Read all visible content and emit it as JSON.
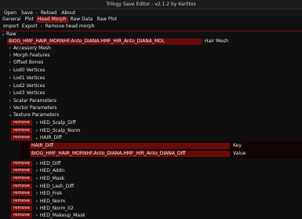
{
  "window": {
    "title": "Trilogy Save Editor - v2.1.2 by Karlitos"
  },
  "menubar": {
    "items": [
      "Open",
      "Save",
      "Reload",
      "About"
    ],
    "separators": [
      "-",
      "-"
    ]
  },
  "tabs": [
    "General",
    "Plot",
    "Head Morph",
    "Raw Data",
    "Raw Plot"
  ],
  "active_tab": "Head Morph",
  "actions": {
    "import": "Import",
    "export": "Export",
    "remove": "Remove head morph",
    "sep": "-"
  },
  "tree": {
    "raw_label": "Raw",
    "hair_mesh_value": "BIOG_HMF_HAIR_MORNHF.Anto_DIANA.HMF_HIR_Anto_DIANA_MDL",
    "hair_mesh_label": "Hair Mesh",
    "sections": [
      "Accessory Mesh",
      "Morph Features",
      "Offset Bones",
      "Lod0 Vertices",
      "Lod1 Vertices",
      "Lod2 Vertices",
      "Lod3 Vertices",
      "Scalar Parameters",
      "Vector Parameters",
      "Texture Parameters"
    ],
    "remove_label": "remove",
    "texture_items_top": [
      "HED_Scalp_Diff",
      "HED_Scalp_Norm",
      "HAIR_Diff"
    ],
    "hair_key_value": "HAIR_Diff",
    "hair_key_label": "Key",
    "hair_value_value": "BIOG_HMF_HAIR_MORNHF.Anto_DIANA.HMF_HIR_Anto_DIANA_Diff",
    "hair_value_label": "Value",
    "texture_items_bottom": [
      "HED_Diff",
      "HED_Addn",
      "HED_Mask",
      "HED_Lash_Diff",
      "HED_Frek",
      "HED_Norm",
      "HED_Norm_02",
      "HED_Makeup_Mask"
    ]
  },
  "colors": {
    "accent": "#7a1111",
    "field": "#6a0b0b",
    "background": "#0f0f10"
  }
}
